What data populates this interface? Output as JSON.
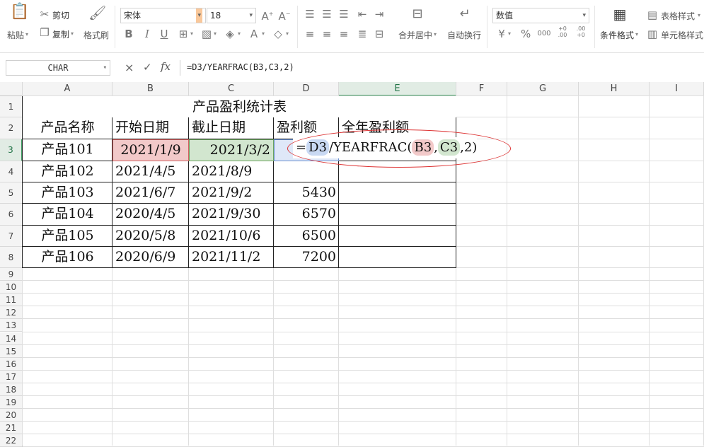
{
  "ribbon": {
    "paste": "粘贴",
    "cut": "剪切",
    "copy": "复制",
    "format_painter": "格式刷",
    "font_name": "宋体",
    "font_size": "18",
    "merge_center": "合并居中",
    "wrap_text": "自动换行",
    "number_format": "数值",
    "conditional_format": "条件格式",
    "table_style": "表格样式",
    "cell_style": "单元格样式",
    "bold": "B",
    "italic": "I",
    "underline": "U",
    "font_color_glyph": "A",
    "currency_glyph": "¥",
    "percent_glyph": "%",
    "thousands_glyph": "000",
    "inc_dec_glyph": "+0 .00",
    "dec_dec_glyph": ".00 +0"
  },
  "formula_bar": {
    "name_box": "CHAR",
    "cancel_glyph": "×",
    "confirm_glyph": "✓",
    "fx_glyph": "fx",
    "formula": "=D3/YEARFRAC(B3,C3,2)"
  },
  "columns": [
    "A",
    "B",
    "C",
    "D",
    "E",
    "F",
    "G",
    "H",
    "I"
  ],
  "rows": [
    "1",
    "2",
    "3",
    "4",
    "5",
    "6",
    "7",
    "8",
    "9",
    "10",
    "11",
    "12",
    "13",
    "14",
    "15",
    "16",
    "17",
    "18",
    "19",
    "20",
    "21",
    "22"
  ],
  "sheet": {
    "title": "产品盈利统计表",
    "headers": [
      "产品名称",
      "开始日期",
      "截止日期",
      "盈利额",
      "全年盈利额"
    ],
    "data": [
      [
        "产品101",
        "2021/1/9",
        "2021/3/2",
        ""
      ],
      [
        "产品102",
        "2021/4/5",
        "2021/8/9",
        ""
      ],
      [
        "产品103",
        "2021/6/7",
        "2021/9/2",
        "5430"
      ],
      [
        "产品104",
        "2020/4/5",
        "2021/9/30",
        "6570"
      ],
      [
        "产品105",
        "2020/5/8",
        "2021/10/6",
        "6500"
      ],
      [
        "产品106",
        "2020/6/9",
        "2021/11/2",
        "7200"
      ]
    ]
  },
  "edit_overlay": {
    "eq": "=",
    "ref1": "D3",
    "func": "/YEARFRAC(",
    "ref2": "B3",
    "comma1": ",",
    "ref3": "C3",
    "tail": ",2)"
  },
  "colors": {
    "accent_green": "#3c9a5f",
    "ref_blue": "#c9d9f3",
    "ref_red": "#f2c9c9",
    "ref_green": "#d2e6cf",
    "annotation_red": "#d33"
  }
}
